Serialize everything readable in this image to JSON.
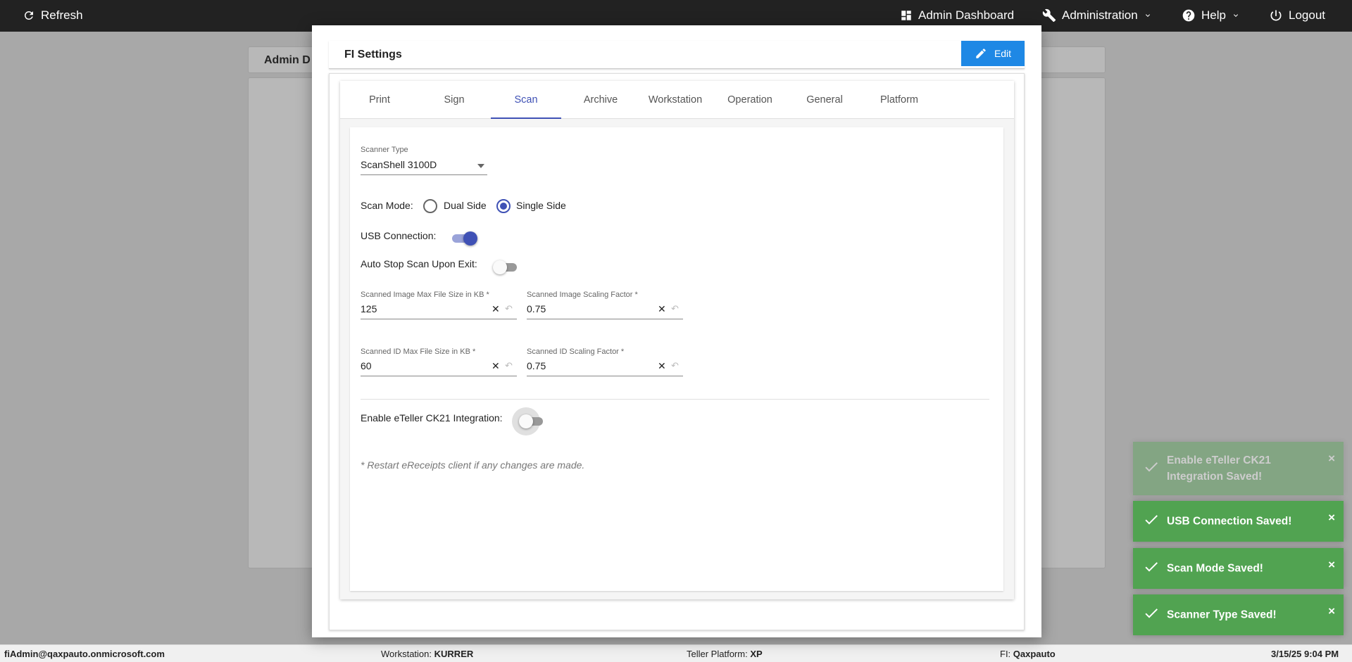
{
  "topbar": {
    "refresh_label": "Refresh",
    "dashboard_label": "Admin Dashboard",
    "administration_label": "Administration",
    "help_label": "Help",
    "logout_label": "Logout"
  },
  "background": {
    "card_title": "Admin D"
  },
  "modal": {
    "title": "FI Settings",
    "edit_label": "Edit",
    "tabs": [
      "Print",
      "Sign",
      "Scan",
      "Archive",
      "Workstation",
      "Operation",
      "General",
      "Platform"
    ],
    "active_tab": "Scan"
  },
  "scan": {
    "scanner_type_label": "Scanner Type",
    "scanner_type_value": "ScanShell 3100D",
    "scan_mode_label": "Scan Mode:",
    "scan_mode_options": [
      "Dual Side",
      "Single Side"
    ],
    "scan_mode_selected": "Single Side",
    "usb_label": "USB Connection:",
    "usb_on": true,
    "auto_stop_label": "Auto Stop Scan Upon Exit:",
    "auto_stop_on": false,
    "img_max_label": "Scanned Image Max File Size in KB *",
    "img_max_value": "125",
    "img_scale_label": "Scanned Image Scaling Factor *",
    "img_scale_value": "0.75",
    "id_max_label": "Scanned ID Max File Size in KB *",
    "id_max_value": "60",
    "id_scale_label": "Scanned ID Scaling Factor *",
    "id_scale_value": "0.75",
    "eteller_label": "Enable eTeller CK21 Integration:",
    "eteller_on": false,
    "note": "* Restart eReceipts client if any changes are made."
  },
  "toasts": [
    {
      "message": "Enable eTeller CK21 Integration Saved!",
      "faded": true
    },
    {
      "message": "USB Connection Saved!",
      "faded": false
    },
    {
      "message": "Scan Mode Saved!",
      "faded": false
    },
    {
      "message": "Scanner Type Saved!",
      "faded": false
    }
  ],
  "toast_close": "×",
  "footer": {
    "user": "fiAdmin@qaxpauto.onmicrosoft.com",
    "workstation_label": "Workstation:",
    "workstation_value": "KURRER",
    "platform_label": "Teller Platform:",
    "platform_value": "XP",
    "fi_label": "FI:",
    "fi_value": "Qaxpauto",
    "datetime": "3/15/25 9:04 PM"
  },
  "colors": {
    "accent": "#3f51b5",
    "edit_button": "#1e88e5",
    "toast_success": "#51a351",
    "topbar": "#222222"
  }
}
